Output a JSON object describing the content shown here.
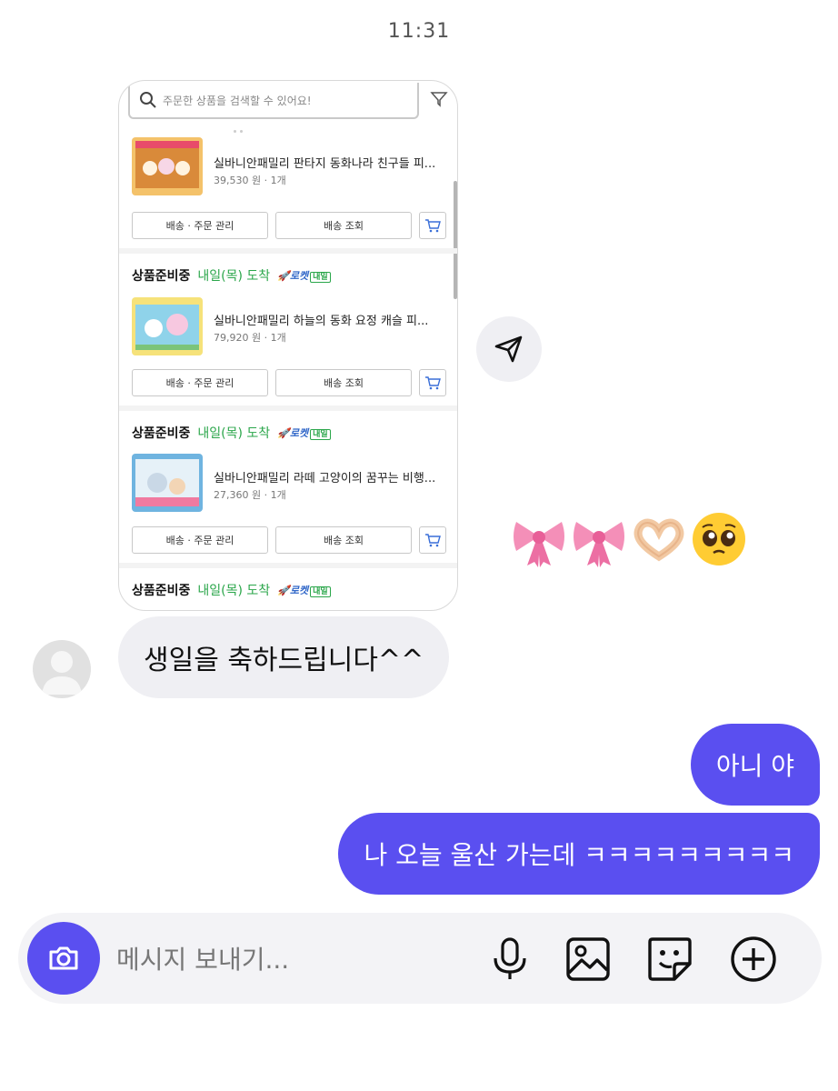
{
  "status_bar": {
    "time": "11:31"
  },
  "shared_card": {
    "search_placeholder": "주문한 상품을 검색할 수 있어요!",
    "orders": [
      {
        "status": "",
        "arrive": "",
        "product_name": "실바니안패밀리 판타지 동화나라 친구들 피...",
        "price_qty": "39,530 원 · 1개",
        "btn_manage": "배송 · 주문 관리",
        "btn_track": "배송 조회"
      },
      {
        "status": "상품준비중",
        "arrive": "내일(목) 도착",
        "rocket": "로켓",
        "rocket_tag": "내일",
        "product_name": "실바니안패밀리 하늘의 동화 요정 캐슬 피...",
        "price_qty": "79,920 원 · 1개",
        "btn_manage": "배송 · 주문 관리",
        "btn_track": "배송 조회"
      },
      {
        "status": "상품준비중",
        "arrive": "내일(목) 도착",
        "rocket": "로켓",
        "rocket_tag": "내일",
        "product_name": "실바니안패밀리 라떼 고양이의 꿈꾸는 비행...",
        "price_qty": "27,360 원 · 1개",
        "btn_manage": "배송 · 주문 관리",
        "btn_track": "배송 조회"
      },
      {
        "status": "상품준비중",
        "arrive": "내일(목) 도착",
        "rocket": "로켓",
        "rocket_tag": "내일"
      }
    ]
  },
  "messages": {
    "incoming": "생일을 축하드립니다^^",
    "outgoing_1": "아니 야",
    "outgoing_2": "나 오늘 울산 가는데 ㅋㅋㅋㅋㅋㅋㅋㅋㅋ"
  },
  "reaction": {
    "icons": [
      "ribbon-icon",
      "ribbon-icon",
      "heart-hands-icon",
      "pleading-face-icon"
    ]
  },
  "composer": {
    "placeholder": "메시지 보내기...",
    "accent": "#5a4ff0"
  },
  "colors": {
    "outgoing_bubble": "#5a4ff0",
    "incoming_bubble": "#efeff3",
    "arrive_green": "#2aa64a"
  }
}
